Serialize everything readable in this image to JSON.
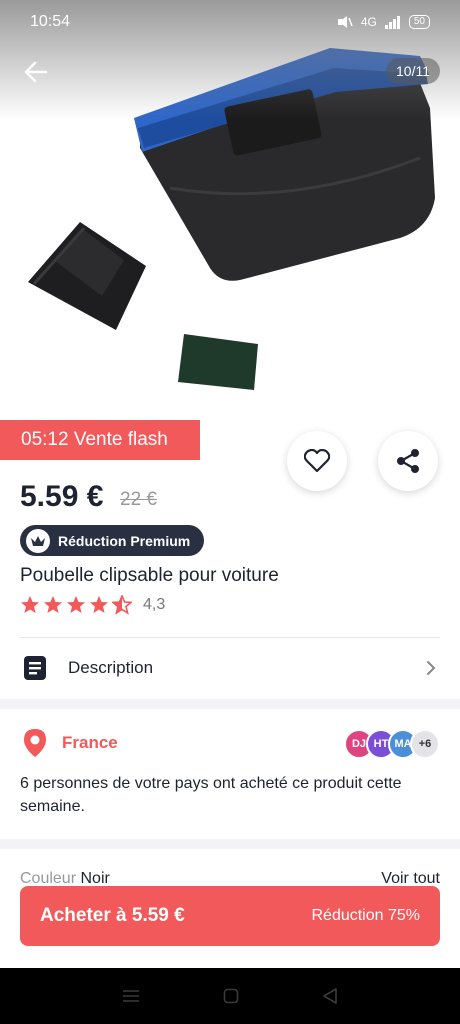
{
  "status_bar": {
    "time": "10:54",
    "network": "4G",
    "battery": "50"
  },
  "gallery": {
    "counter": "10/11"
  },
  "flash_sale": {
    "label": "05:12 Vente flash"
  },
  "pricing": {
    "price": "5.59 €",
    "old_price": "22 €"
  },
  "premium_badge": {
    "label": "Réduction Premium"
  },
  "product": {
    "title": "Poubelle clipsable pour voiture",
    "rating": "4,3",
    "rating_stars": 4.5
  },
  "description": {
    "label": "Description"
  },
  "location": {
    "country": "France"
  },
  "buyers": {
    "avatars": [
      "DJ",
      "HT",
      "MA"
    ],
    "avatar_colors": [
      "#e0447f",
      "#7a4fd6",
      "#4a8fd8"
    ],
    "more": "+6",
    "message": "6 personnes de votre pays ont acheté ce produit cette semaine."
  },
  "variant": {
    "key": "Couleur",
    "value": "Noir",
    "see_all": "Voir tout"
  },
  "buy_bar": {
    "label": "Acheter à 5.59 €",
    "discount": "Réduction 75%"
  },
  "colors": {
    "accent": "#f2595a",
    "dark": "#283042"
  }
}
